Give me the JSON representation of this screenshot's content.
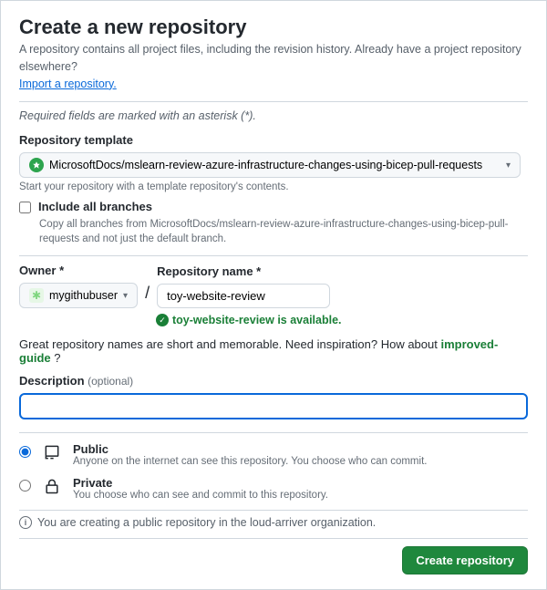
{
  "header": {
    "title": "Create a new repository",
    "subtitle": "A repository contains all project files, including the revision history. Already have a project repository elsewhere?",
    "import_link": "Import a repository."
  },
  "required_note": "Required fields are marked with an asterisk (*).",
  "template": {
    "label": "Repository template",
    "selected": "MicrosoftDocs/mslearn-review-azure-infrastructure-changes-using-bicep-pull-requests",
    "hint": "Start your repository with a template repository's contents."
  },
  "include_branches": {
    "label": "Include all branches",
    "description": "Copy all branches from MicrosoftDocs/mslearn-review-azure-infrastructure-changes-using-bicep-pull-requests and not just the default branch.",
    "checked": false
  },
  "owner": {
    "label": "Owner *",
    "value": "mygithubuser"
  },
  "repo_name": {
    "label": "Repository name *",
    "value": "toy-website-review",
    "available_text": "toy-website-review is available."
  },
  "inspiration": {
    "prefix": "Great repository names are short and memorable. Need inspiration? How about ",
    "suggestion": "improved-guide",
    "suffix": " ?"
  },
  "description": {
    "label": "Description",
    "optional": "(optional)",
    "value": ""
  },
  "visibility": {
    "public": {
      "title": "Public",
      "desc": "Anyone on the internet can see this repository. You choose who can commit."
    },
    "private": {
      "title": "Private",
      "desc": "You choose who can see and commit to this repository."
    },
    "selected": "public"
  },
  "info_note": "You are creating a public repository in the loud-arriver organization.",
  "submit_label": "Create repository"
}
